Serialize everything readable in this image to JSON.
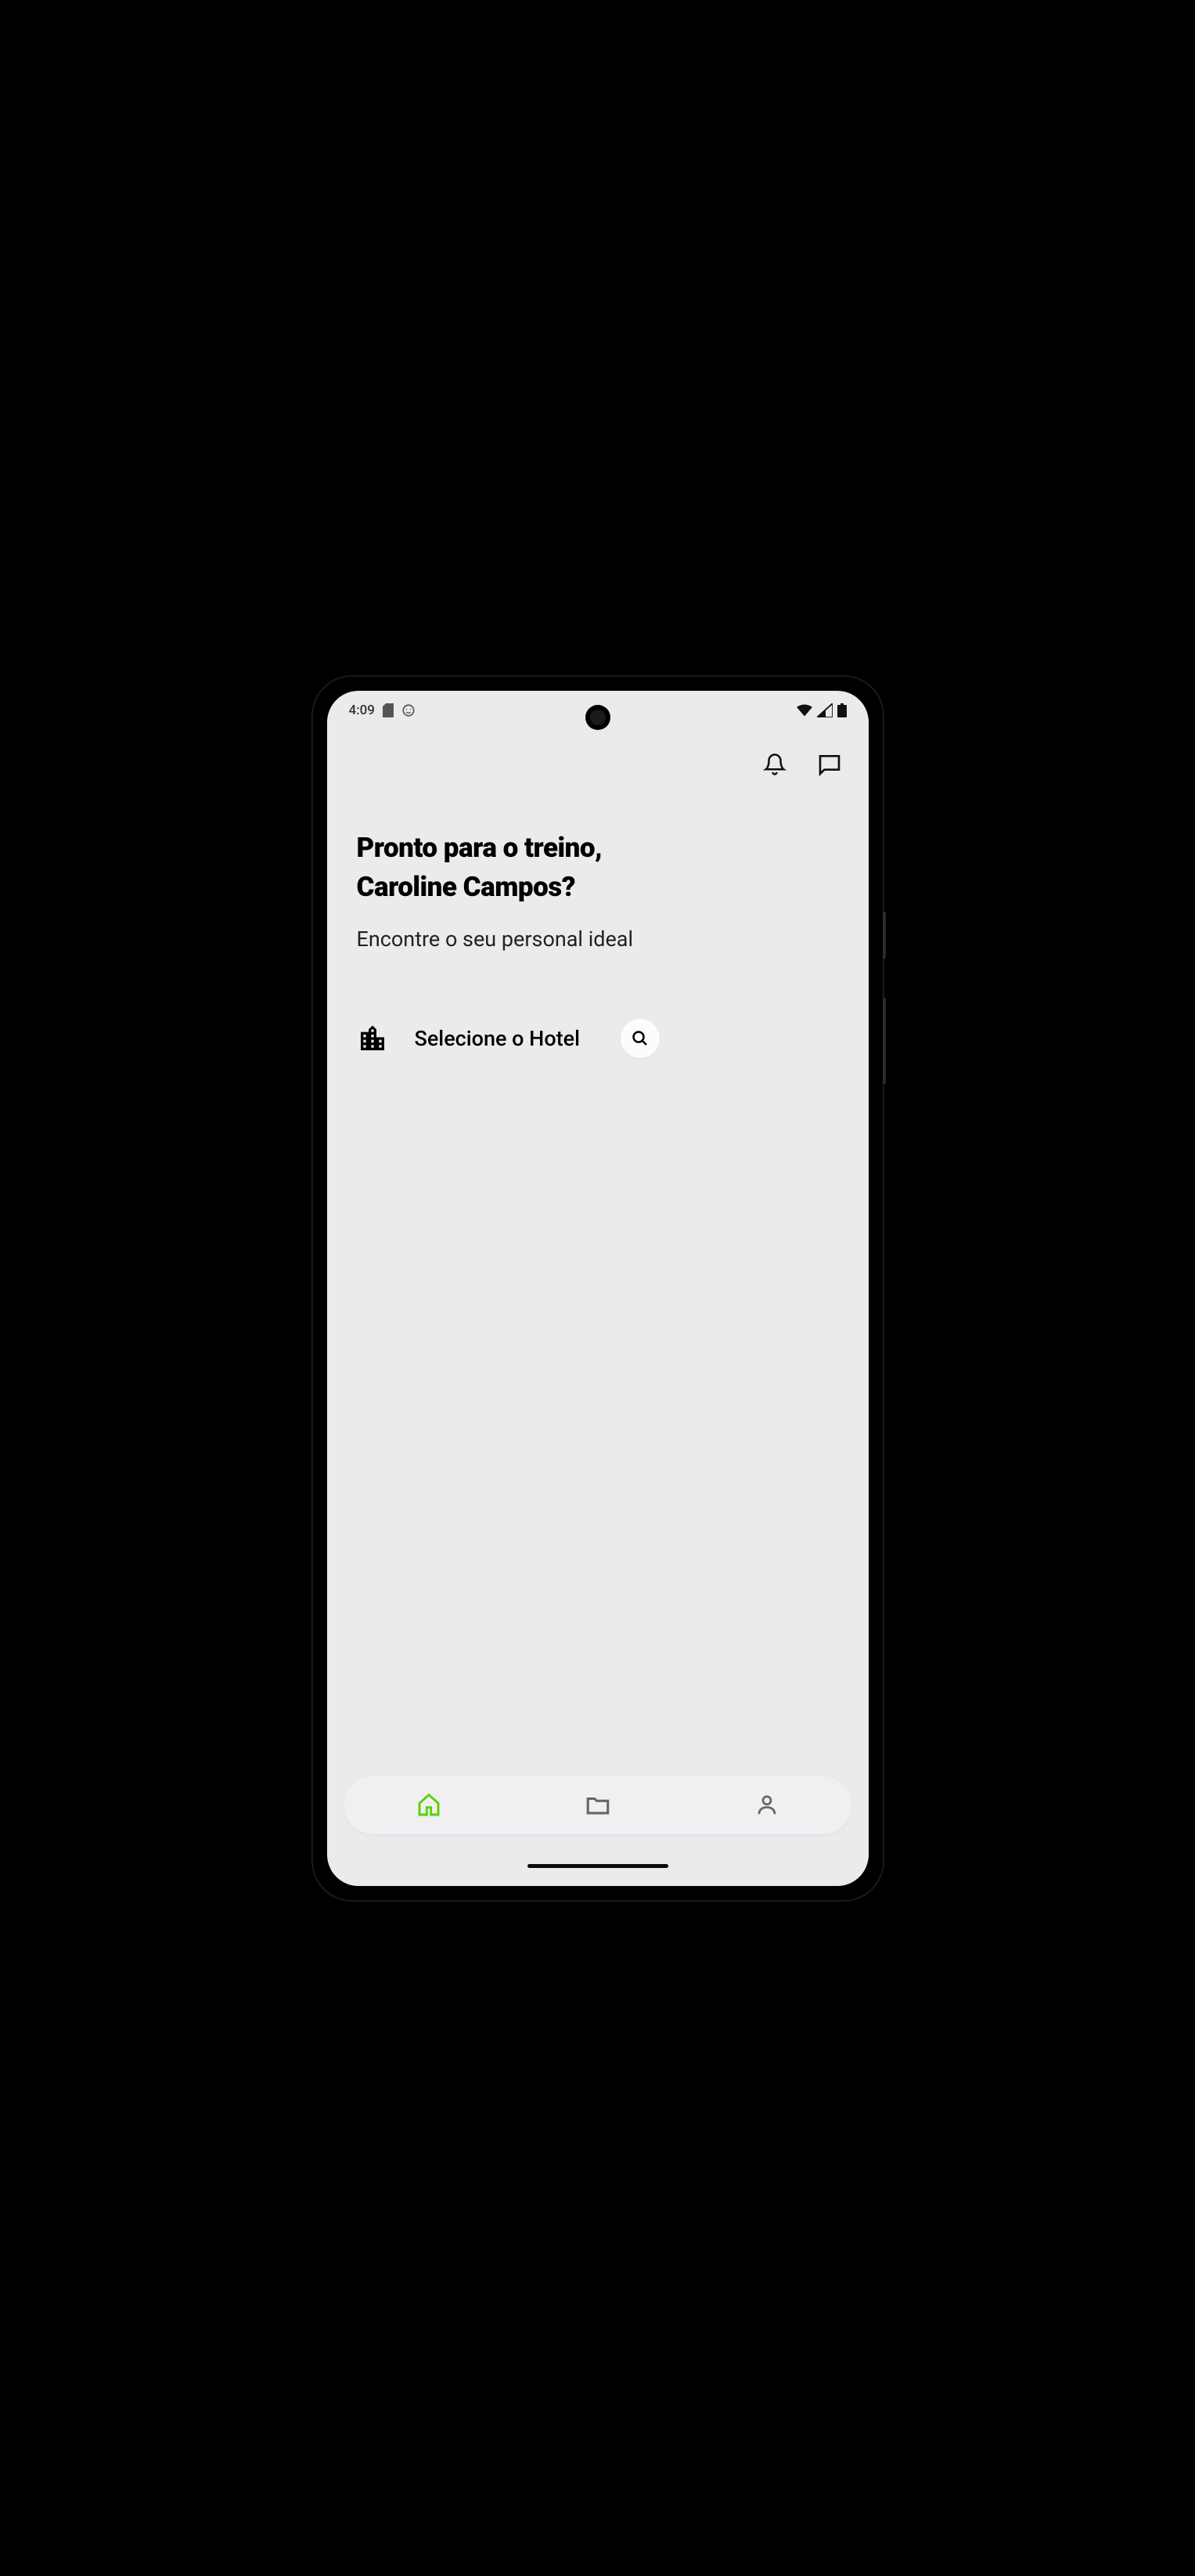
{
  "status_bar": {
    "time": "4:09"
  },
  "greeting": {
    "title_line1": "Pronto para o treino,",
    "title_line2": "Caroline Campos?",
    "subtitle": "Encontre o seu personal ideal"
  },
  "hotel_selector": {
    "label": "Selecione o Hotel"
  },
  "colors": {
    "active_nav": "#5fd000",
    "inactive_nav": "#666"
  }
}
